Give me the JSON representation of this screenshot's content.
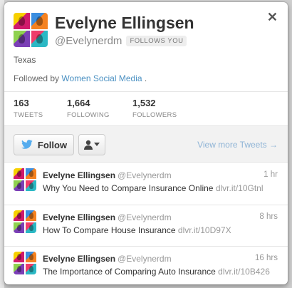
{
  "profile": {
    "name": "Evelyne Ellingsen",
    "handle": "@Evelynerdm",
    "follows_you": "FOLLOWS YOU",
    "location": "Texas",
    "followed_by_prefix": "Followed by",
    "followed_by_link": "Women Social Media",
    "followed_by_suffix": "."
  },
  "stats": [
    {
      "value": "163",
      "label": "TWEETS"
    },
    {
      "value": "1,664",
      "label": "FOLLOWING"
    },
    {
      "value": "1,532",
      "label": "FOLLOWERS"
    }
  ],
  "actions": {
    "follow_label": "Follow",
    "view_more": "View more Tweets →",
    "close": "✕"
  },
  "tweets": [
    {
      "name": "Evelyne Ellingsen",
      "handle": "@Evelynerdm",
      "time": "1 hr",
      "text": "Why You Need to Compare Insurance Online",
      "link": "dlvr.it/10Gtnl"
    },
    {
      "name": "Evelyne Ellingsen",
      "handle": "@Evelynerdm",
      "time": "8 hrs",
      "text": "How To Compare House Insurance",
      "link": "dlvr.it/10D97X"
    },
    {
      "name": "Evelyne Ellingsen",
      "handle": "@Evelynerdm",
      "time": "16 hrs",
      "text": "The Importance of Comparing Auto Insurance",
      "link": "dlvr.it/10B426"
    }
  ],
  "colors": {
    "link": "#4a90c2",
    "bird": "#55acee"
  }
}
